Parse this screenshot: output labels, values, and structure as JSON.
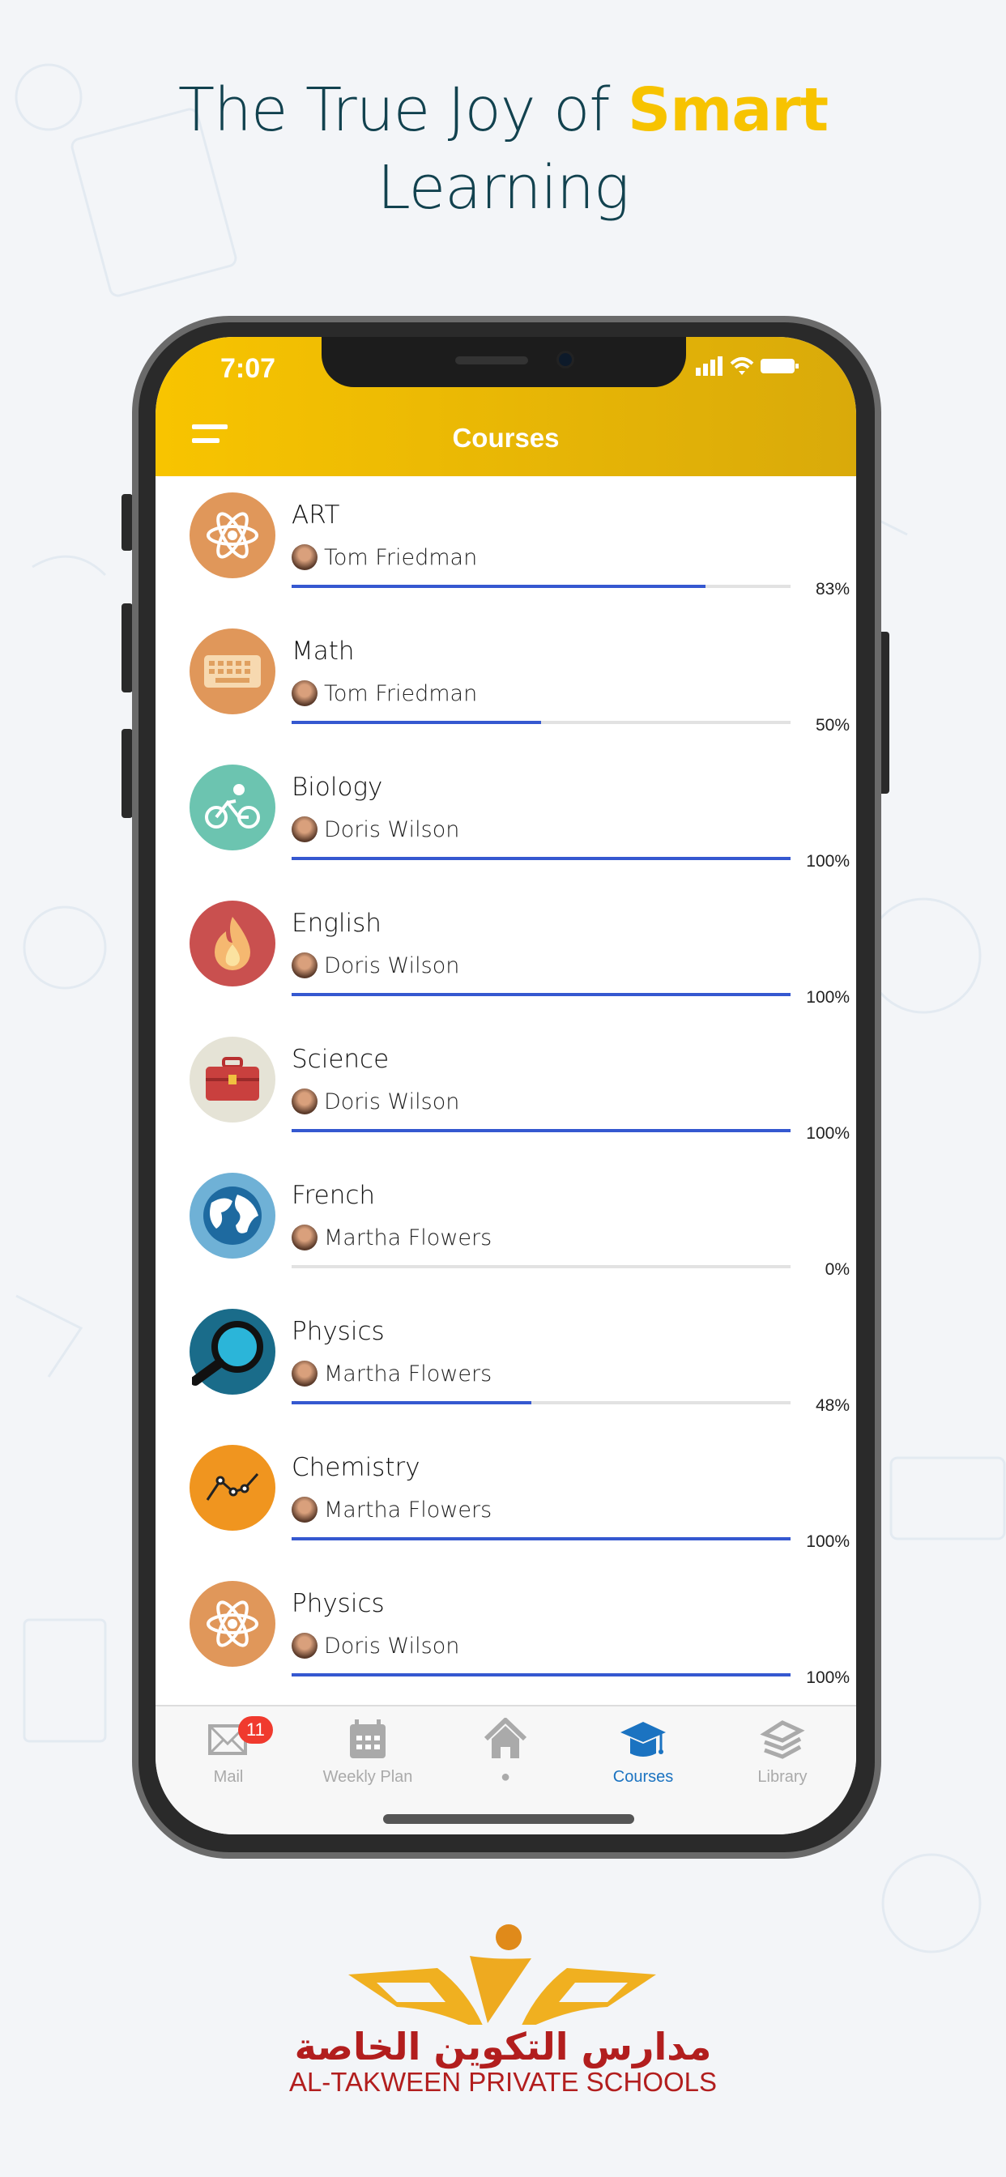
{
  "headline": {
    "line1": "The True Joy of",
    "highlight": "Smart",
    "line2": "Learning"
  },
  "status": {
    "time": "7:07"
  },
  "header": {
    "title": "Courses"
  },
  "colors": {
    "accent": "#f8c400",
    "progress": "#3558d0",
    "active_tab": "#1b73c1",
    "badge": "#f03a2e",
    "brand_red": "#b21e1e"
  },
  "courses": [
    {
      "name": "ART",
      "teacher": "Tom Friedman",
      "progress": 83,
      "progress_label": "83%",
      "icon": "atom-icon",
      "color": "#e0975a"
    },
    {
      "name": "Math",
      "teacher": "Tom Friedman",
      "progress": 50,
      "progress_label": "50%",
      "icon": "keyboard-icon",
      "color": "#e0975a"
    },
    {
      "name": "Biology",
      "teacher": "Doris Wilson",
      "progress": 100,
      "progress_label": "100%",
      "icon": "bicycle-icon",
      "color": "#6cc4b0"
    },
    {
      "name": "English",
      "teacher": "Doris Wilson",
      "progress": 100,
      "progress_label": "100%",
      "icon": "flame-icon",
      "color": "#c9504f"
    },
    {
      "name": "Science",
      "teacher": "Doris Wilson",
      "progress": 100,
      "progress_label": "100%",
      "icon": "toolbox-icon",
      "color": "#e5e3d6"
    },
    {
      "name": "French",
      "teacher": "Martha Flowers",
      "progress": 0,
      "progress_label": "0%",
      "icon": "globe-icon",
      "color": "#6fb1d6"
    },
    {
      "name": "Physics",
      "teacher": "Martha Flowers",
      "progress": 48,
      "progress_label": "48%",
      "icon": "magnifier-icon",
      "color": "#1a6c8a"
    },
    {
      "name": "Chemistry",
      "teacher": "Martha Flowers",
      "progress": 100,
      "progress_label": "100%",
      "icon": "line-chart-icon",
      "color": "#f0951f"
    },
    {
      "name": "Physics",
      "teacher": "Doris Wilson",
      "progress": 100,
      "progress_label": "100%",
      "icon": "atom-icon",
      "color": "#e0975a"
    }
  ],
  "tabs": [
    {
      "label": "Mail",
      "icon": "mail-icon",
      "badge": "11"
    },
    {
      "label": "Weekly Plan",
      "icon": "calendar-icon"
    },
    {
      "label": "●",
      "icon": "home-icon"
    },
    {
      "label": "Courses",
      "icon": "graduation-cap-icon",
      "active": true
    },
    {
      "label": "Library",
      "icon": "books-icon"
    }
  ],
  "brand": {
    "arabic": "مدارس التكوين الخاصة",
    "english": "AL-TAKWEEN PRIVATE SCHOOLS"
  }
}
